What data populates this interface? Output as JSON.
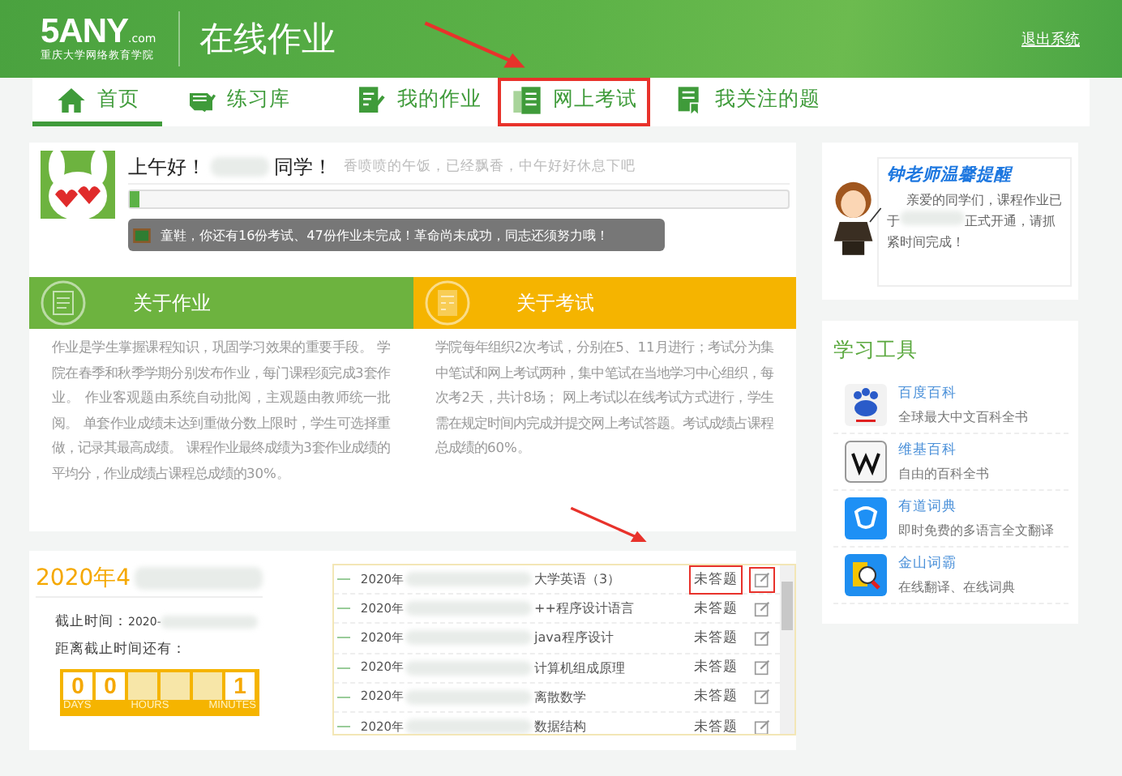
{
  "header": {
    "logo": "5ANY",
    "logo_suffix": ".com",
    "logo_subtitle": "重庆大学网络教育学院",
    "title": "在线作业",
    "logout": "退出系统"
  },
  "nav": [
    {
      "kind": "home",
      "label": "首页",
      "selected": true,
      "highlighted": false
    },
    {
      "kind": "library",
      "label": "练习库",
      "selected": false,
      "highlighted": false
    },
    {
      "kind": "homework",
      "label": "我的作业",
      "selected": false,
      "highlighted": false
    },
    {
      "kind": "exam",
      "label": "网上考试",
      "selected": false,
      "highlighted": true
    },
    {
      "kind": "bookmark",
      "label": "我关注的题",
      "selected": false,
      "highlighted": false
    }
  ],
  "welcome": {
    "greeting": "上午好！",
    "greeting_suffix": "同学！",
    "subtitle": "香喷喷的午饭，已经飘香，中午好好休息下吧",
    "level": 0.015,
    "notice": "童鞋，你还有16份考试、47份作业未完成！革命尚未成功，同志还须努力哦！"
  },
  "info_panels": [
    {
      "kind": "homework",
      "title": "关于作业",
      "color": "#6db33f",
      "text": "作业是学生掌握课程知识，巩固学习效果的重要手段。 学院在春季和秋季学期分别发布作业，每门课程须完成3套作业。 作业客观题由系统自动批阅，主观题由教师统一批阅。 单套作业成绩未达到重做分数上限时，学生可选择重做，记录其最高成绩。 课程作业最终成绩为3套作业成绩的平均分，作业成绩占课程总成绩的30%。"
    },
    {
      "kind": "exam",
      "title": "关于考试",
      "color": "#f5b400",
      "text": "学院每年组织2次考试，分别在5、11月进行；考试分为集中笔试和网上考试两种，集中笔试在当地学习中心组织，每次考2天，共计8场； 网上考试以在线考试方式进行，学生需在规定时间内完成并提交网上考试答题。考试成绩占课程总成绩的60%。"
    }
  ],
  "exam": {
    "title": "2020年4",
    "deadline_label": "截止时间：",
    "deadline_value": "2020-",
    "remaining_label": "距离截止时间还有：",
    "countdown": [
      {
        "digit": "0",
        "blurred": false
      },
      {
        "digit": "0",
        "blurred": false
      },
      {
        "blurred": true
      },
      {
        "blurred": true
      },
      {
        "blurred": true
      },
      {
        "digit": "1",
        "blurred": false
      }
    ],
    "units": [
      "DAYS",
      "HOURS",
      "MINUTES"
    ],
    "rows": [
      {
        "date": "2020年",
        "course": "大学英语（3）",
        "status": "未答题",
        "highlighted": true
      },
      {
        "date": "2020年",
        "course": "++程序设计语言",
        "status": "未答题",
        "highlighted": false
      },
      {
        "date": "2020年",
        "course": "java程序设计",
        "status": "未答题",
        "highlighted": false
      },
      {
        "date": "2020年",
        "course": "计算机组成原理",
        "status": "未答题",
        "highlighted": false
      },
      {
        "date": "2020年",
        "course": "离散数学",
        "status": "未答题",
        "highlighted": false
      },
      {
        "date": "2020年",
        "course": "数据结构",
        "status": "未答题",
        "highlighted": false
      }
    ]
  },
  "reminder": {
    "title": "钟老师温馨提醒",
    "text_before": "亲爱的同学们，课程作业已于",
    "text_after": "正式开通，请抓紧时间完成！"
  },
  "tools": {
    "title": "学习工具",
    "items": [
      {
        "kind": "baidu",
        "name": "百度百科",
        "description": "全球最大中文百科全书"
      },
      {
        "kind": "wiki",
        "name": "维基百科",
        "description": "自由的百科全书"
      },
      {
        "kind": "youdao",
        "name": "有道词典",
        "description": "即时免费的多语言全文翻译"
      },
      {
        "kind": "iciba",
        "name": "金山词霸",
        "description": "在线翻译、在线词典"
      }
    ]
  }
}
